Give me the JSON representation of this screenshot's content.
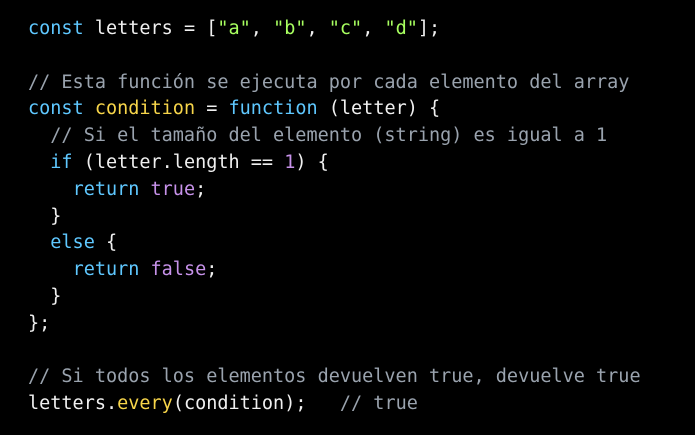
{
  "code": {
    "lines": [
      [
        {
          "t": "const",
          "c": "kw"
        },
        {
          "t": " letters = [",
          "c": "var"
        },
        {
          "t": "\"a\"",
          "c": "str"
        },
        {
          "t": ", ",
          "c": "pun"
        },
        {
          "t": "\"b\"",
          "c": "str"
        },
        {
          "t": ", ",
          "c": "pun"
        },
        {
          "t": "\"c\"",
          "c": "str"
        },
        {
          "t": ", ",
          "c": "pun"
        },
        {
          "t": "\"d\"",
          "c": "str"
        },
        {
          "t": "];",
          "c": "pun"
        }
      ],
      [],
      [
        {
          "t": "// Esta función se ejecuta por cada elemento del array",
          "c": "cm"
        }
      ],
      [
        {
          "t": "const",
          "c": "kw"
        },
        {
          "t": " ",
          "c": "pun"
        },
        {
          "t": "condition",
          "c": "fn"
        },
        {
          "t": " = ",
          "c": "pun"
        },
        {
          "t": "function",
          "c": "kw"
        },
        {
          "t": " (letter) {",
          "c": "var"
        }
      ],
      [
        {
          "t": "  // Si el tamaño del elemento (string) es igual a 1",
          "c": "cm"
        }
      ],
      [
        {
          "t": "  ",
          "c": "pun"
        },
        {
          "t": "if",
          "c": "kw"
        },
        {
          "t": " (letter.length == ",
          "c": "var"
        },
        {
          "t": "1",
          "c": "num"
        },
        {
          "t": ") {",
          "c": "pun"
        }
      ],
      [
        {
          "t": "    ",
          "c": "pun"
        },
        {
          "t": "return",
          "c": "kw"
        },
        {
          "t": " ",
          "c": "pun"
        },
        {
          "t": "true",
          "c": "bool"
        },
        {
          "t": ";",
          "c": "pun"
        }
      ],
      [
        {
          "t": "  }",
          "c": "pun"
        }
      ],
      [
        {
          "t": "  ",
          "c": "pun"
        },
        {
          "t": "else",
          "c": "kw"
        },
        {
          "t": " {",
          "c": "pun"
        }
      ],
      [
        {
          "t": "    ",
          "c": "pun"
        },
        {
          "t": "return",
          "c": "kw"
        },
        {
          "t": " ",
          "c": "pun"
        },
        {
          "t": "false",
          "c": "bool"
        },
        {
          "t": ";",
          "c": "pun"
        }
      ],
      [
        {
          "t": "  }",
          "c": "pun"
        }
      ],
      [
        {
          "t": "};",
          "c": "pun"
        }
      ],
      [],
      [
        {
          "t": "// Si todos los elementos devuelven true, devuelve true",
          "c": "cm"
        }
      ],
      [
        {
          "t": "letters.",
          "c": "var"
        },
        {
          "t": "every",
          "c": "fn"
        },
        {
          "t": "(condition);   ",
          "c": "var"
        },
        {
          "t": "// true",
          "c": "cm"
        }
      ]
    ]
  },
  "colors": {
    "background": "#000000",
    "keyword": "#5fc8ff",
    "string": "#a8ff60",
    "comment": "#9aa3ae",
    "function": "#f7d54a",
    "literal": "#c792ea",
    "text": "#f0f0f0"
  }
}
